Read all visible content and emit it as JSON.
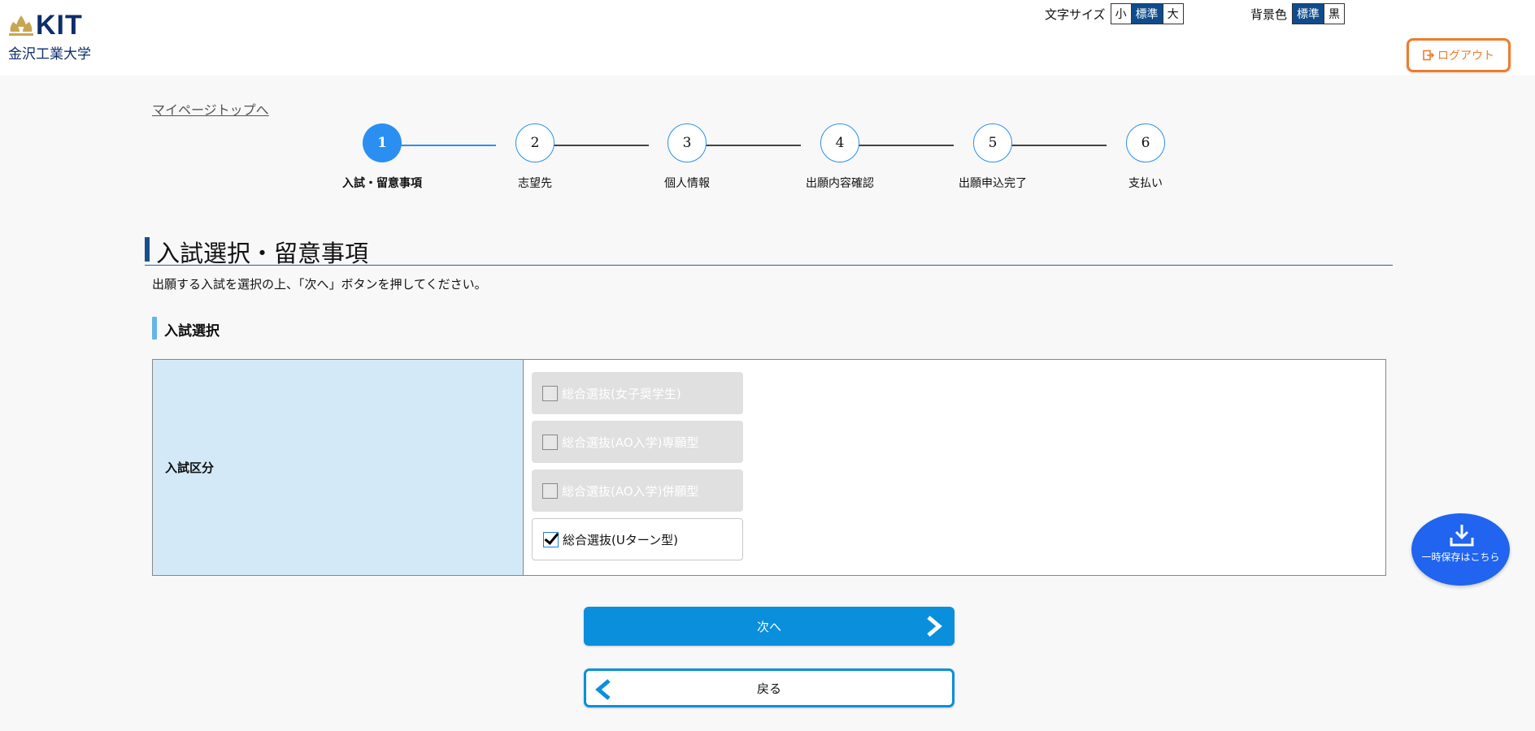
{
  "header": {
    "logo": {
      "brand": "KIT",
      "name": "金沢工業大学"
    },
    "font_size": {
      "label": "文字サイズ",
      "options": [
        "小",
        "標準",
        "大"
      ],
      "selected": "標準"
    },
    "background": {
      "label": "背景色",
      "options": [
        "標準",
        "黒"
      ],
      "selected": "標準"
    },
    "logout_label": "ログアウト"
  },
  "nav": {
    "mypage_link": "マイページトップへ"
  },
  "stepper": {
    "current": 1,
    "steps": [
      {
        "number": "1",
        "label": "入試・留意事項"
      },
      {
        "number": "2",
        "label": "志望先"
      },
      {
        "number": "3",
        "label": "個人情報"
      },
      {
        "number": "4",
        "label": "出願内容確認"
      },
      {
        "number": "5",
        "label": "出願申込完了"
      },
      {
        "number": "6",
        "label": "支払い"
      }
    ]
  },
  "page": {
    "title": "入試選択・留意事項",
    "instruction": "出願する入試を選択の上、「次へ」ボタンを押してください。",
    "section_heading": "入試選択"
  },
  "exam_table": {
    "row_header": "入試区分",
    "options": [
      {
        "label": "総合選抜(女子奨学生)",
        "enabled": false,
        "checked": false
      },
      {
        "label": "総合選抜(AO入学)専願型",
        "enabled": false,
        "checked": false
      },
      {
        "label": "総合選抜(AO入学)併願型",
        "enabled": false,
        "checked": false
      },
      {
        "label": "総合選抜(Uターン型)",
        "enabled": true,
        "checked": true
      }
    ]
  },
  "buttons": {
    "next": "次へ",
    "back": "戻る"
  },
  "save_button": {
    "label": "一時保存はこちら"
  },
  "colors": {
    "primary": "#0a8fdd",
    "step_active": "#2a8ff0",
    "logout": "#f07b2b",
    "table_header_bg": "#d3e9f8",
    "fab": "#2064ef",
    "title_bar": "#1b4f8c"
  }
}
